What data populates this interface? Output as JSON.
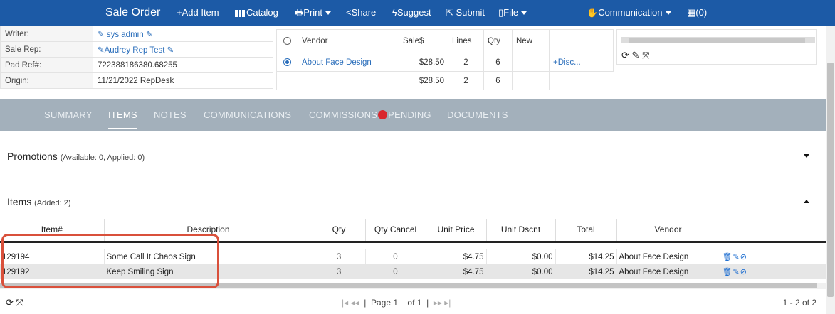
{
  "toolbar": {
    "title": "Sale Order",
    "add_item": "+Add Item",
    "catalog": "Catalog",
    "print": "Print",
    "share": "Share",
    "suggest": "Suggest",
    "submit": "Submit",
    "file": "File",
    "communication": "Communication",
    "cart_count": "(0)",
    "bar_color": "#1c5aa6"
  },
  "info": [
    {
      "label": "Writer:",
      "value": "sys admin",
      "is_link": true
    },
    {
      "label": "Sale Rep:",
      "value": "Audrey Rep Test",
      "is_link": true
    },
    {
      "label": "Pad Ref#:",
      "value": "722388186380.68255",
      "is_link": false
    },
    {
      "label": "Origin:",
      "value": "11/21/2022 RepDesk",
      "is_link": false
    }
  ],
  "vendors": {
    "headers": [
      "Vendor",
      "Sale$",
      "Lines",
      "Qty",
      "New"
    ],
    "rows": [
      {
        "vendor": "About Face Design",
        "sale": "$28.50",
        "lines": "2",
        "qty": "6",
        "new": "",
        "action": "+Disc...",
        "selected": true
      }
    ],
    "totals": {
      "sale": "$28.50",
      "lines": "2",
      "qty": "6"
    }
  },
  "tabs": [
    "SUMMARY",
    "ITEMS",
    "NOTES",
    "COMMUNICATIONS",
    "COMMISSIONS",
    "PENDING",
    "DOCUMENTS"
  ],
  "active_tab": "ITEMS",
  "promotions": {
    "title": "Promotions",
    "detail": "(Available: 0, Applied: 0)"
  },
  "items_section": {
    "title": "Items",
    "detail": "(Added: 2)"
  },
  "items": {
    "columns": [
      "Item#",
      "Description",
      "Qty",
      "Qty Cancel",
      "Unit Price",
      "Unit Dscnt",
      "Total",
      "Vendor"
    ],
    "rows": [
      {
        "item": "129194",
        "description": "Some Call It Chaos Sign",
        "qty": "3",
        "qty_cancel": "0",
        "unit_price": "$4.75",
        "unit_dscnt": "$0.00",
        "total": "$14.25",
        "vendor": "About Face Design"
      },
      {
        "item": "129192",
        "description": "Keep Smiling Sign",
        "qty": "3",
        "qty_cancel": "0",
        "unit_price": "$4.75",
        "unit_dscnt": "$0.00",
        "total": "$14.25",
        "vendor": "About Face Design"
      }
    ]
  },
  "pager": {
    "page_label": "Page",
    "page": "1",
    "of_label": "of 1",
    "count": "1 - 2 of 2"
  }
}
